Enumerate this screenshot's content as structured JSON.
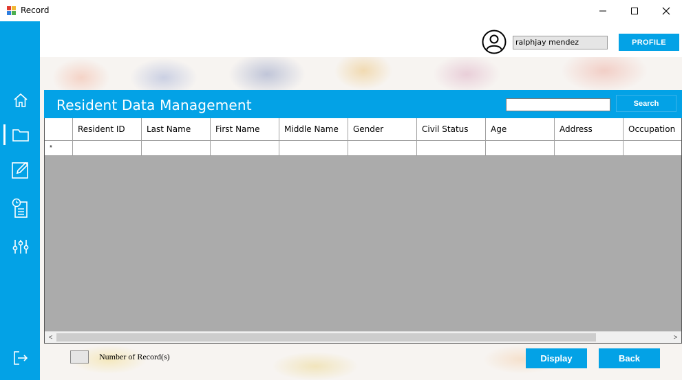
{
  "window": {
    "title": "Record",
    "minimize_glyph": "—",
    "maximize_glyph": "☐",
    "close_glyph": "✕"
  },
  "sidebar": {
    "items": [
      {
        "icon": "home-icon"
      },
      {
        "icon": "folder-icon",
        "active": true
      },
      {
        "icon": "edit-icon"
      },
      {
        "icon": "clipboard-clock-icon"
      },
      {
        "icon": "sliders-icon"
      }
    ],
    "logout_icon": "logout-icon"
  },
  "header": {
    "username": "ralphjay mendez",
    "profile_label": "PROFILE"
  },
  "panel": {
    "title": "Resident Data Management",
    "search_placeholder": "",
    "search_label": "Search"
  },
  "grid": {
    "columns": [
      "Resident ID",
      "Last Name",
      "First Name",
      "Middle Name",
      "Gender",
      "Civil Status",
      "Age",
      "Address",
      "Occupation"
    ],
    "new_row_marker": "*",
    "scroll_left": "<",
    "scroll_right": ">"
  },
  "footer": {
    "count_value": "",
    "count_label": "Number of Record(s)",
    "display_label": "Display",
    "back_label": "Back"
  },
  "colors": {
    "accent": "#03a2e6",
    "grid_bg": "#ababab"
  }
}
